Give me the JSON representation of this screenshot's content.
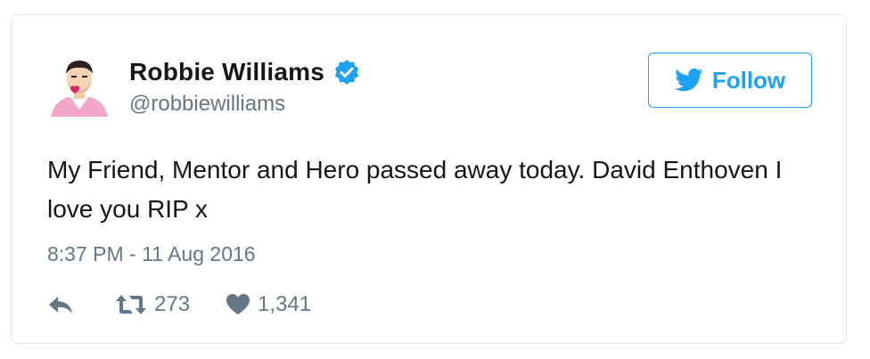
{
  "tweet": {
    "user": {
      "display_name": "Robbie Williams",
      "handle": "@robbiewilliams",
      "verified": true
    },
    "follow_label": "Follow",
    "text": "My Friend, Mentor and Hero passed away today. David Enthoven I love you RIP x",
    "timestamp": "8:37 PM - 11 Aug 2016",
    "retweets": "273",
    "likes": "1,341"
  },
  "icons": [
    "avatar-emoji",
    "verified-badge-icon",
    "twitter-bird-icon",
    "reply-icon",
    "retweet-icon",
    "heart-icon"
  ],
  "colors": {
    "accent": "#1da1f2",
    "verified": "#1da1f2",
    "text": "#14171a",
    "muted": "#657786",
    "border": "#e1e8ed"
  }
}
